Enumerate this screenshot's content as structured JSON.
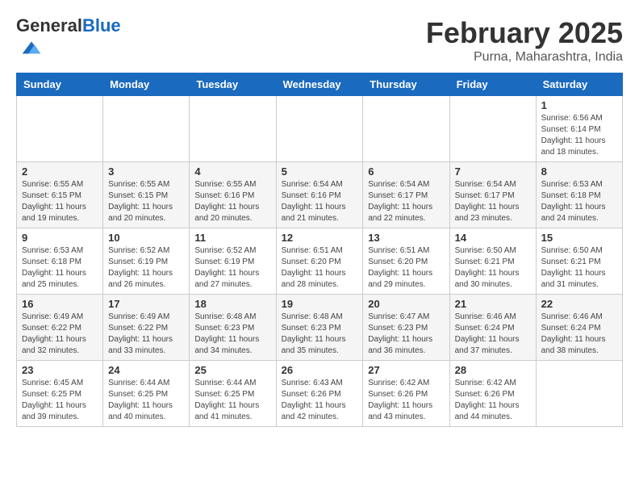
{
  "header": {
    "logo_general": "General",
    "logo_blue": "Blue",
    "main_title": "February 2025",
    "sub_title": "Purna, Maharashtra, India"
  },
  "calendar": {
    "days_of_week": [
      "Sunday",
      "Monday",
      "Tuesday",
      "Wednesday",
      "Thursday",
      "Friday",
      "Saturday"
    ],
    "weeks": [
      [
        {
          "day": "",
          "info": ""
        },
        {
          "day": "",
          "info": ""
        },
        {
          "day": "",
          "info": ""
        },
        {
          "day": "",
          "info": ""
        },
        {
          "day": "",
          "info": ""
        },
        {
          "day": "",
          "info": ""
        },
        {
          "day": "1",
          "info": "Sunrise: 6:56 AM\nSunset: 6:14 PM\nDaylight: 11 hours\nand 18 minutes."
        }
      ],
      [
        {
          "day": "2",
          "info": "Sunrise: 6:55 AM\nSunset: 6:15 PM\nDaylight: 11 hours\nand 19 minutes."
        },
        {
          "day": "3",
          "info": "Sunrise: 6:55 AM\nSunset: 6:15 PM\nDaylight: 11 hours\nand 20 minutes."
        },
        {
          "day": "4",
          "info": "Sunrise: 6:55 AM\nSunset: 6:16 PM\nDaylight: 11 hours\nand 20 minutes."
        },
        {
          "day": "5",
          "info": "Sunrise: 6:54 AM\nSunset: 6:16 PM\nDaylight: 11 hours\nand 21 minutes."
        },
        {
          "day": "6",
          "info": "Sunrise: 6:54 AM\nSunset: 6:17 PM\nDaylight: 11 hours\nand 22 minutes."
        },
        {
          "day": "7",
          "info": "Sunrise: 6:54 AM\nSunset: 6:17 PM\nDaylight: 11 hours\nand 23 minutes."
        },
        {
          "day": "8",
          "info": "Sunrise: 6:53 AM\nSunset: 6:18 PM\nDaylight: 11 hours\nand 24 minutes."
        }
      ],
      [
        {
          "day": "9",
          "info": "Sunrise: 6:53 AM\nSunset: 6:18 PM\nDaylight: 11 hours\nand 25 minutes."
        },
        {
          "day": "10",
          "info": "Sunrise: 6:52 AM\nSunset: 6:19 PM\nDaylight: 11 hours\nand 26 minutes."
        },
        {
          "day": "11",
          "info": "Sunrise: 6:52 AM\nSunset: 6:19 PM\nDaylight: 11 hours\nand 27 minutes."
        },
        {
          "day": "12",
          "info": "Sunrise: 6:51 AM\nSunset: 6:20 PM\nDaylight: 11 hours\nand 28 minutes."
        },
        {
          "day": "13",
          "info": "Sunrise: 6:51 AM\nSunset: 6:20 PM\nDaylight: 11 hours\nand 29 minutes."
        },
        {
          "day": "14",
          "info": "Sunrise: 6:50 AM\nSunset: 6:21 PM\nDaylight: 11 hours\nand 30 minutes."
        },
        {
          "day": "15",
          "info": "Sunrise: 6:50 AM\nSunset: 6:21 PM\nDaylight: 11 hours\nand 31 minutes."
        }
      ],
      [
        {
          "day": "16",
          "info": "Sunrise: 6:49 AM\nSunset: 6:22 PM\nDaylight: 11 hours\nand 32 minutes."
        },
        {
          "day": "17",
          "info": "Sunrise: 6:49 AM\nSunset: 6:22 PM\nDaylight: 11 hours\nand 33 minutes."
        },
        {
          "day": "18",
          "info": "Sunrise: 6:48 AM\nSunset: 6:23 PM\nDaylight: 11 hours\nand 34 minutes."
        },
        {
          "day": "19",
          "info": "Sunrise: 6:48 AM\nSunset: 6:23 PM\nDaylight: 11 hours\nand 35 minutes."
        },
        {
          "day": "20",
          "info": "Sunrise: 6:47 AM\nSunset: 6:23 PM\nDaylight: 11 hours\nand 36 minutes."
        },
        {
          "day": "21",
          "info": "Sunrise: 6:46 AM\nSunset: 6:24 PM\nDaylight: 11 hours\nand 37 minutes."
        },
        {
          "day": "22",
          "info": "Sunrise: 6:46 AM\nSunset: 6:24 PM\nDaylight: 11 hours\nand 38 minutes."
        }
      ],
      [
        {
          "day": "23",
          "info": "Sunrise: 6:45 AM\nSunset: 6:25 PM\nDaylight: 11 hours\nand 39 minutes."
        },
        {
          "day": "24",
          "info": "Sunrise: 6:44 AM\nSunset: 6:25 PM\nDaylight: 11 hours\nand 40 minutes."
        },
        {
          "day": "25",
          "info": "Sunrise: 6:44 AM\nSunset: 6:25 PM\nDaylight: 11 hours\nand 41 minutes."
        },
        {
          "day": "26",
          "info": "Sunrise: 6:43 AM\nSunset: 6:26 PM\nDaylight: 11 hours\nand 42 minutes."
        },
        {
          "day": "27",
          "info": "Sunrise: 6:42 AM\nSunset: 6:26 PM\nDaylight: 11 hours\nand 43 minutes."
        },
        {
          "day": "28",
          "info": "Sunrise: 6:42 AM\nSunset: 6:26 PM\nDaylight: 11 hours\nand 44 minutes."
        },
        {
          "day": "",
          "info": ""
        }
      ]
    ]
  }
}
